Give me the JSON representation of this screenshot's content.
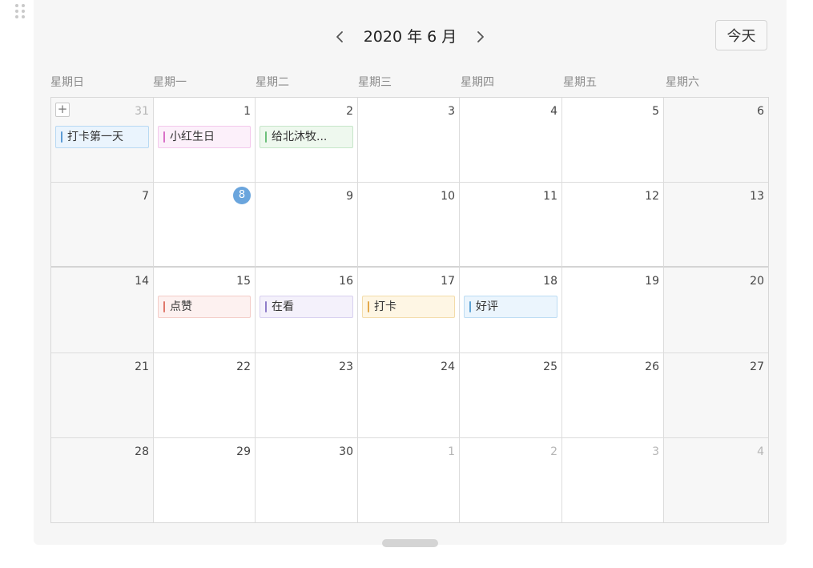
{
  "header": {
    "prev_icon": "chevron-left-icon",
    "next_icon": "chevron-right-icon",
    "month_title": "2020 年 6 月",
    "today_label": "今天"
  },
  "weekdays": [
    "星期日",
    "星期一",
    "星期二",
    "星期三",
    "星期四",
    "星期五",
    "星期六"
  ],
  "weeks": [
    [
      {
        "day": "31",
        "muted": true,
        "weekend": true,
        "add_button": "+",
        "event": {
          "title": "打卡第一天",
          "color": "#5b9bd5",
          "bg": "#eaf4fd",
          "border": "#b8d9f3"
        }
      },
      {
        "day": "1",
        "event": {
          "title": "小红生日",
          "color": "#d96fc7",
          "bg": "#fcf0fa",
          "border": "#f3c8ec"
        }
      },
      {
        "day": "2",
        "event": {
          "title": "给北沐牧...",
          "color": "#6cbf7a",
          "bg": "#eef8ee",
          "border": "#c6e6c9"
        }
      },
      {
        "day": "3"
      },
      {
        "day": "4"
      },
      {
        "day": "5"
      },
      {
        "day": "6",
        "weekend": true
      }
    ],
    [
      {
        "day": "7",
        "weekend": true
      },
      {
        "day": "8",
        "today": true
      },
      {
        "day": "9"
      },
      {
        "day": "10"
      },
      {
        "day": "11"
      },
      {
        "day": "12"
      },
      {
        "day": "13",
        "weekend": true
      }
    ],
    [
      {
        "day": "14",
        "weekend": true
      },
      {
        "day": "15",
        "event": {
          "title": "点赞",
          "color": "#e0776a",
          "bg": "#fdf1f0",
          "border": "#f3cdc8"
        }
      },
      {
        "day": "16",
        "event": {
          "title": "在看",
          "color": "#8e7cc9",
          "bg": "#f4f1fb",
          "border": "#d8d0ef"
        }
      },
      {
        "day": "17",
        "event": {
          "title": "打卡",
          "color": "#e3a84a",
          "bg": "#fef6e4",
          "border": "#f3dcaa"
        }
      },
      {
        "day": "18",
        "event": {
          "title": "好评",
          "color": "#5ea3d4",
          "bg": "#ebf5fd",
          "border": "#bcdcf3"
        }
      },
      {
        "day": "19"
      },
      {
        "day": "20",
        "weekend": true
      }
    ],
    [
      {
        "day": "21",
        "weekend": true
      },
      {
        "day": "22"
      },
      {
        "day": "23"
      },
      {
        "day": "24"
      },
      {
        "day": "25"
      },
      {
        "day": "26"
      },
      {
        "day": "27",
        "weekend": true
      }
    ],
    [
      {
        "day": "28",
        "weekend": true
      },
      {
        "day": "29"
      },
      {
        "day": "30"
      },
      {
        "day": "1",
        "muted": true
      },
      {
        "day": "2",
        "muted": true
      },
      {
        "day": "3",
        "muted": true
      },
      {
        "day": "4",
        "muted": true,
        "weekend": true
      }
    ]
  ]
}
